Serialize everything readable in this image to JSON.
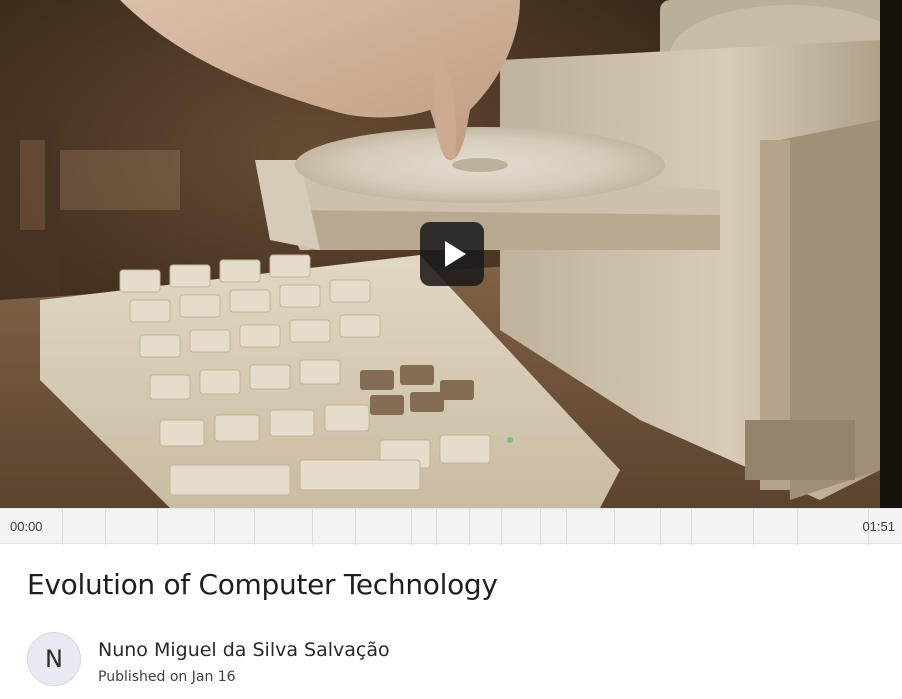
{
  "video": {
    "thumbnail_description_icon": "computer-disc-drive-thumbnail",
    "play_icon": "play-icon",
    "start_time": "00:00",
    "end_time": "01:51"
  },
  "post": {
    "title": "Evolution of Computer Technology",
    "author_initial": "N",
    "author_name": "Nuno Miguel da Silva Salvação",
    "published": "Published on Jan 16"
  },
  "colors": {
    "timeline_bg": "#f3f3f5",
    "play_button_bg": "#1c1a1a",
    "avatar_bg": "#e8eaf2"
  }
}
